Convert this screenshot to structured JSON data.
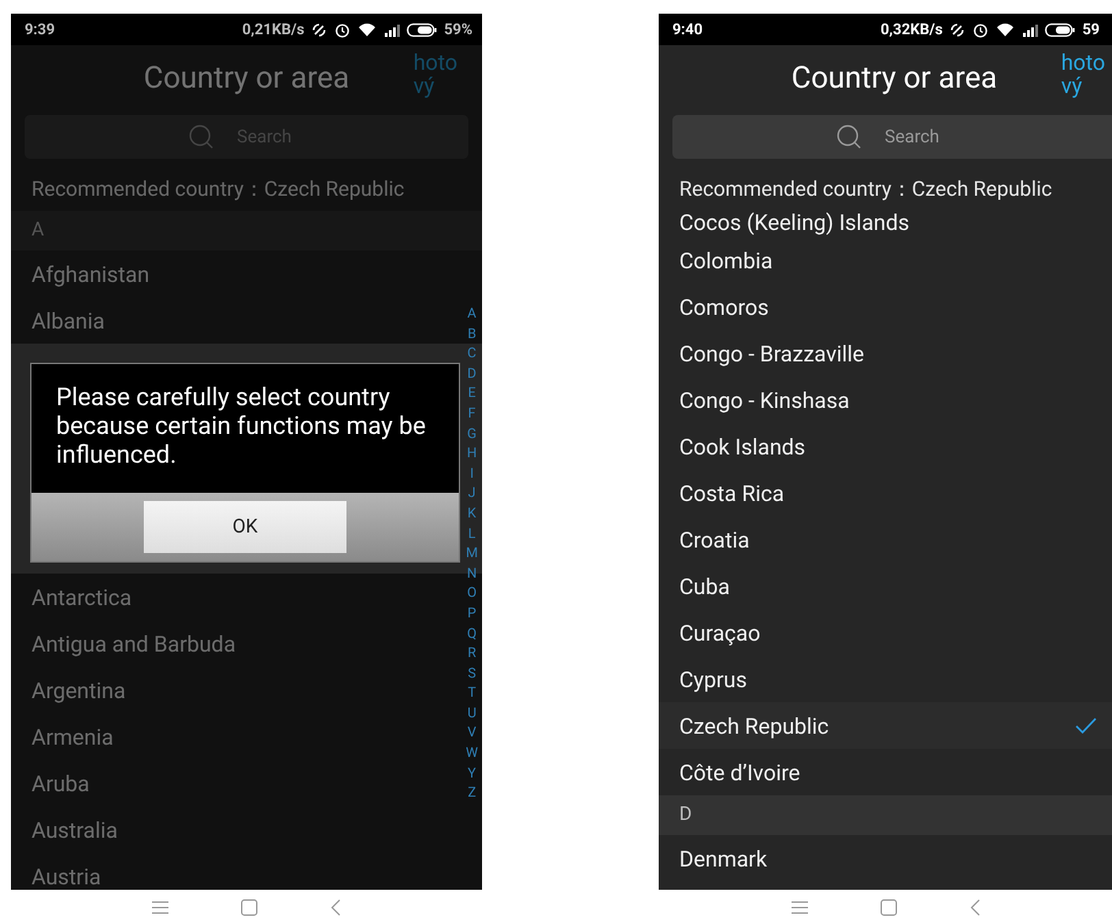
{
  "screens": [
    {
      "dimmed": true,
      "status": {
        "time": "9:39",
        "speed": "0,21KB/s",
        "battery": "59%"
      },
      "title": "Country or area",
      "done_lines": [
        "hoto",
        "vý"
      ],
      "search": {
        "placeholder": "Search"
      },
      "recommended": "Recommended country：Czech Republic",
      "index_letters": [
        "A",
        "B",
        "C",
        "D",
        "E",
        "F",
        "G",
        "H",
        "I",
        "J",
        "K",
        "L",
        "M",
        "N",
        "O",
        "P",
        "Q",
        "R",
        "S",
        "T",
        "U",
        "V",
        "W",
        "Y",
        "Z"
      ],
      "items": [
        {
          "kind": "section",
          "label": "A"
        },
        {
          "kind": "country",
          "label": "Afghanistan",
          "selected": false
        },
        {
          "kind": "country",
          "label": "Albania",
          "selected": false
        },
        {
          "kind": "dialog",
          "message": "Please carefully select country because certain functions may be influenced.",
          "button": "OK"
        },
        {
          "kind": "country",
          "label": "Antarctica",
          "selected": false
        },
        {
          "kind": "country",
          "label": "Antigua and Barbuda",
          "selected": false
        },
        {
          "kind": "country",
          "label": "Argentina",
          "selected": false
        },
        {
          "kind": "country",
          "label": "Armenia",
          "selected": false
        },
        {
          "kind": "country",
          "label": "Aruba",
          "selected": false
        },
        {
          "kind": "country",
          "label": "Australia",
          "selected": false
        },
        {
          "kind": "country",
          "label": "Austria",
          "selected": false
        }
      ]
    },
    {
      "dimmed": false,
      "status": {
        "time": "9:40",
        "speed": "0,32KB/s",
        "battery": "59"
      },
      "title": "Country or area",
      "done_lines": [
        "hoto",
        "vý"
      ],
      "search": {
        "placeholder": "Search"
      },
      "recommended": "Recommended country：Czech Republic",
      "items": [
        {
          "kind": "country",
          "label": "Cocos (Keeling) Islands",
          "selected": false,
          "cut_top": true
        },
        {
          "kind": "country",
          "label": "Colombia",
          "selected": false
        },
        {
          "kind": "country",
          "label": "Comoros",
          "selected": false
        },
        {
          "kind": "country",
          "label": "Congo - Brazzaville",
          "selected": false
        },
        {
          "kind": "country",
          "label": "Congo - Kinshasa",
          "selected": false
        },
        {
          "kind": "country",
          "label": "Cook Islands",
          "selected": false
        },
        {
          "kind": "country",
          "label": "Costa Rica",
          "selected": false
        },
        {
          "kind": "country",
          "label": "Croatia",
          "selected": false
        },
        {
          "kind": "country",
          "label": "Cuba",
          "selected": false
        },
        {
          "kind": "country",
          "label": "Curaçao",
          "selected": false
        },
        {
          "kind": "country",
          "label": "Cyprus",
          "selected": false
        },
        {
          "kind": "country",
          "label": "Czech Republic",
          "selected": true
        },
        {
          "kind": "country",
          "label": "Côte d’Ivoire",
          "selected": false
        },
        {
          "kind": "section",
          "label": "D"
        },
        {
          "kind": "country",
          "label": "Denmark",
          "selected": false
        }
      ]
    }
  ]
}
